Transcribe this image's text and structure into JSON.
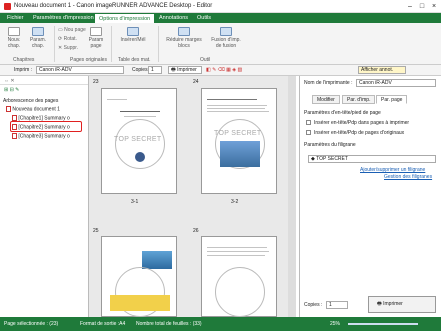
{
  "window": {
    "title": "Nouveau document 1 - Canon imageRUNNER ADVANCE Desktop - Editor"
  },
  "ribbon_tabs": [
    "Fichier",
    "Paramètres d'impression",
    "Options d'impression",
    "Annotations",
    "Outils"
  ],
  "ribbon": {
    "nouv_chap": "Nouv. chap.",
    "param_chap": "Param. chap.",
    "chapitres_group": "Chapitres",
    "nouv_page": "Nou page",
    "rotat": "Rotat.",
    "suppr": "Suppr.",
    "pages_originales_group": "Pages originales",
    "param_page": "Param page",
    "inserer_mel": "Insérer/Mél",
    "table_mat_group": "Table des mat.",
    "reduire": "Réduire marges blocs",
    "fusion": "Fusion d'imp. de fusion",
    "outil_group": "Outil"
  },
  "toolbar": {
    "imprim_label": "Imprim :",
    "printer": "Canon iR-ADV",
    "copies_label": "Copies :",
    "copies_value": "1",
    "imprimer": "Imprimer",
    "afficher_annot": "Afficher annot."
  },
  "tree": {
    "header": "Arborescence des pages",
    "root": "Nouveau document 1",
    "items": [
      "[Chapitre1] Summary o",
      "[Chapitre2] Summary o",
      "[Chapitre3] Summary o"
    ]
  },
  "pages": {
    "page_numbers": [
      "23",
      "24",
      "25",
      "26"
    ],
    "labels": [
      "3-1",
      "3-2"
    ],
    "watermark": "TOP SECRET"
  },
  "right_panel": {
    "printer_label": "Nom de l'imprimante :",
    "printer_value": "Canon iR-ADV",
    "tabs": [
      "Modifier",
      "Par. d'imp.",
      "Par. page"
    ],
    "header_footer_title": "Paramètres d'en-tête/pied de page",
    "opt1": "Insérer en-tête/Pdp dans pages à imprimer",
    "opt2": "Insérer en-tête/Pdp de pages d'originaux",
    "watermark_title": "Paramètres du filigrane",
    "watermark_value": "TOP SECRET",
    "link1": "Ajouter/supprimer un filigrane",
    "link2": "Gestion des filigranes",
    "copies_label": "Copies :",
    "copies_value": "1",
    "print_button": "Imprimer"
  },
  "status": {
    "selected": "Page sélectionnée : (23)",
    "format": "Format de sortie :A4",
    "sheets": "Nombre total de feuilles : (33)",
    "zoom": "25%"
  },
  "colors": {
    "brand_green": "#1f7a3a",
    "highlight": "#e02020"
  }
}
